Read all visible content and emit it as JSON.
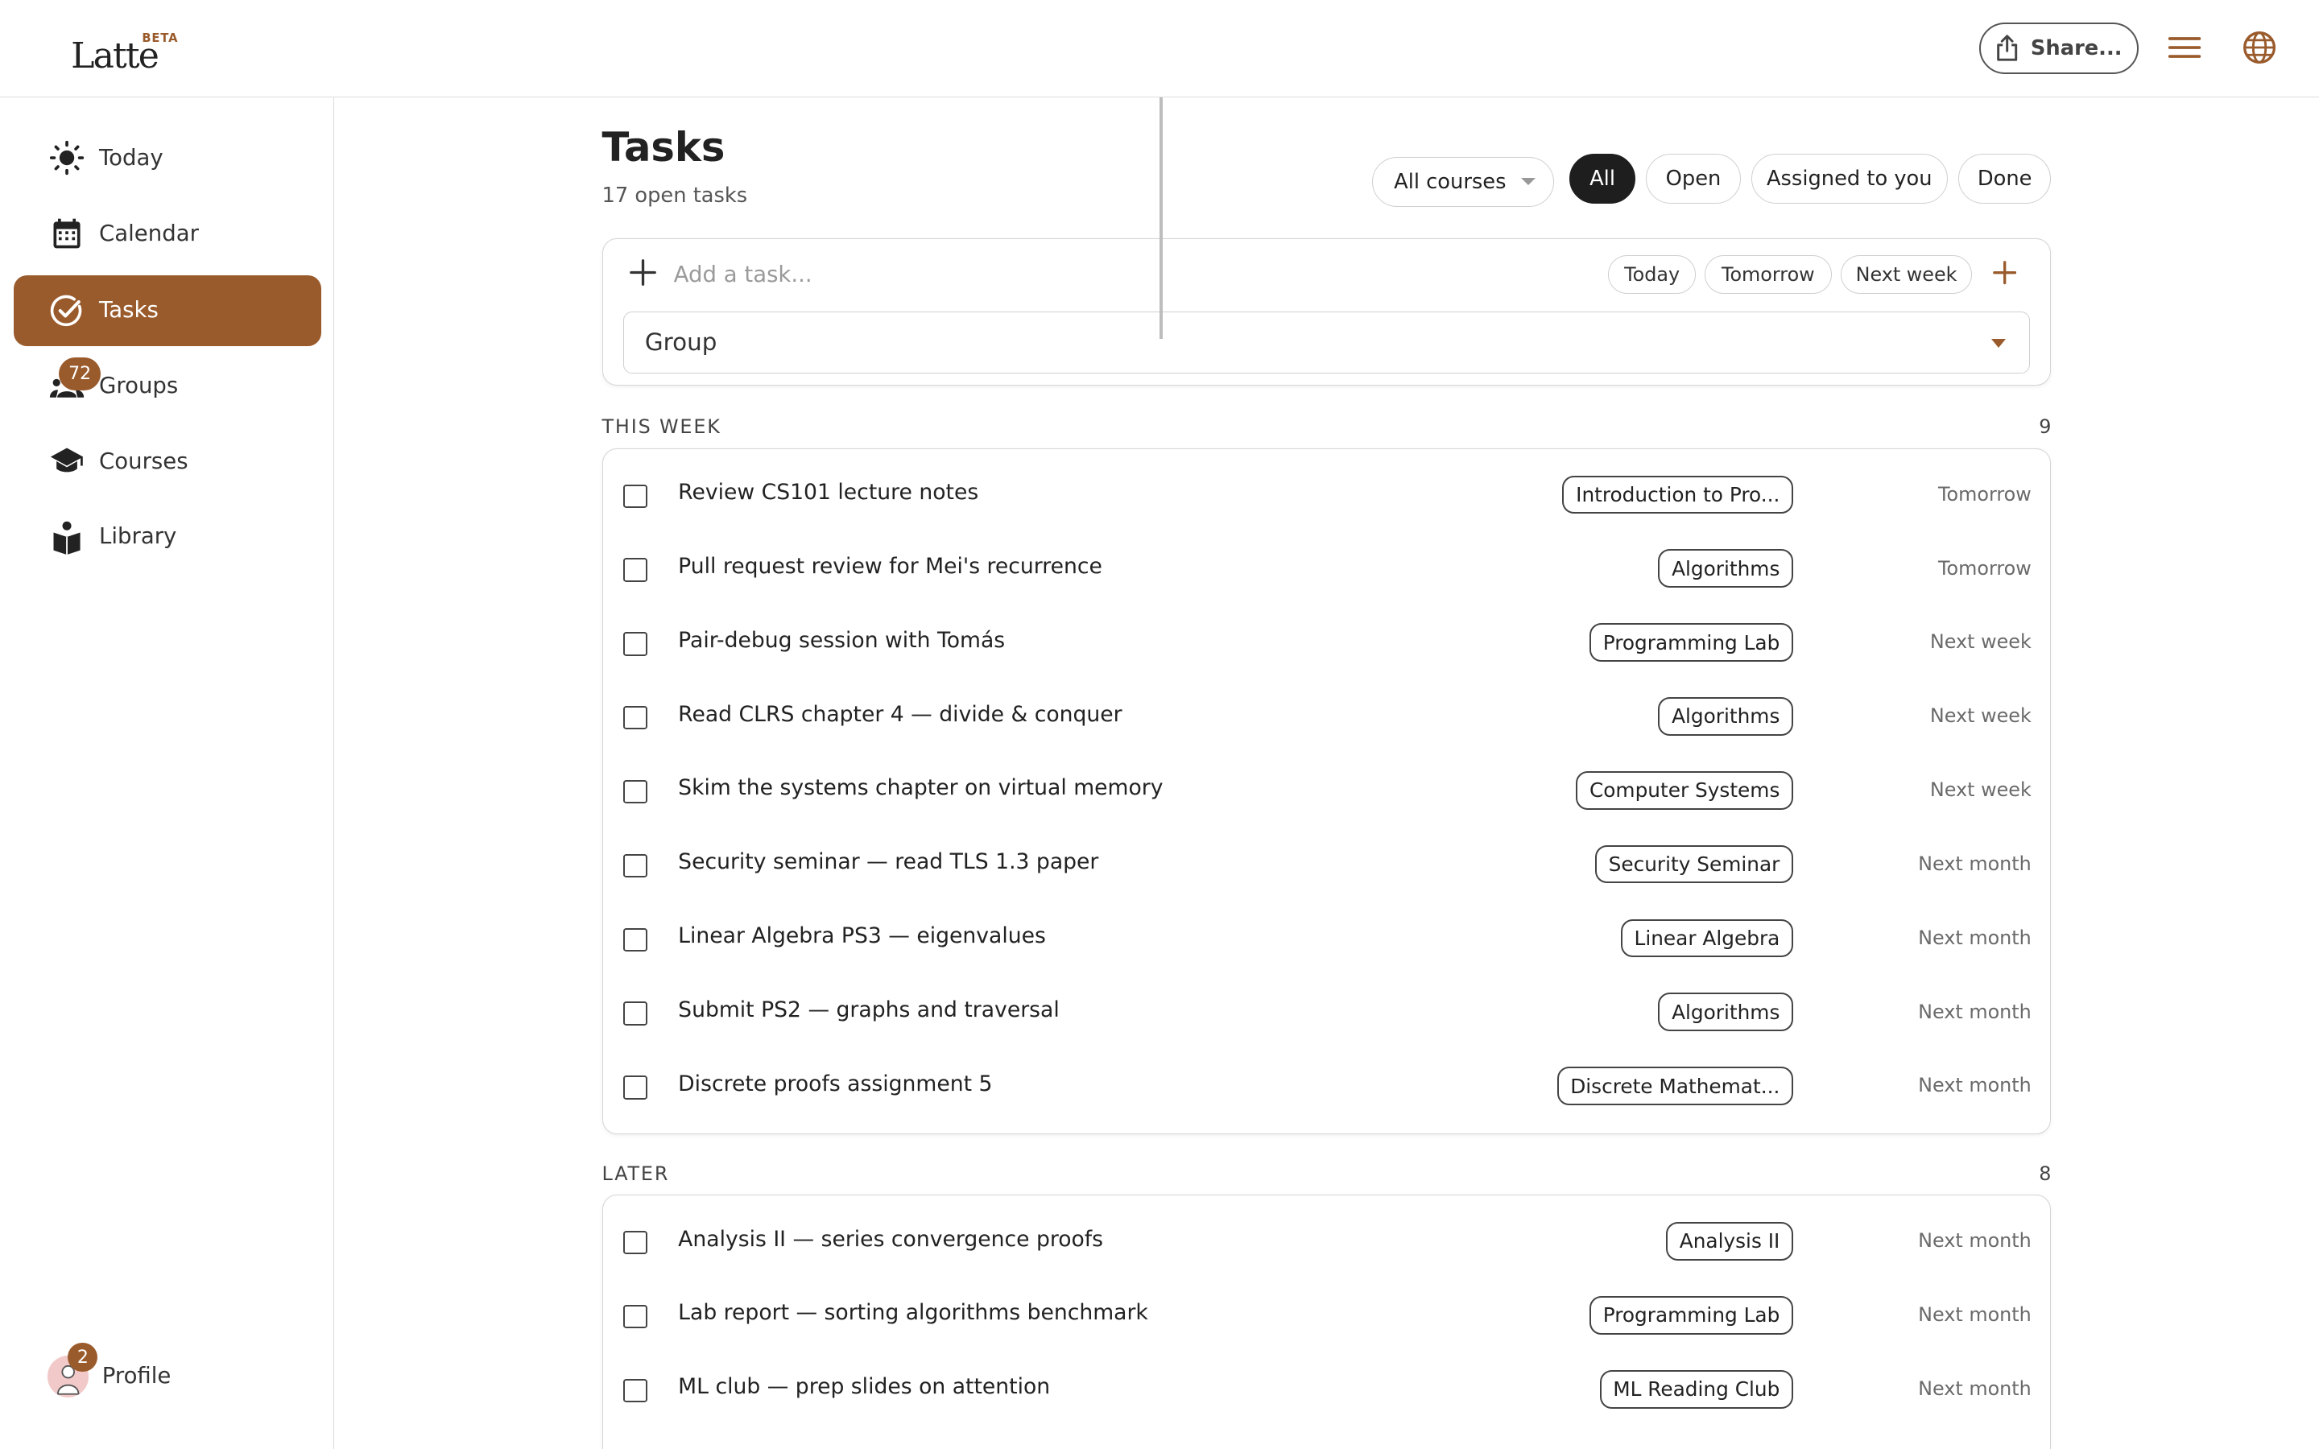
{
  "header": {
    "logo_text": "Latte",
    "beta_label": "BETA",
    "share_label": "Share..."
  },
  "sidebar": {
    "items": [
      {
        "label": "Today",
        "icon": "sun-icon"
      },
      {
        "label": "Calendar",
        "icon": "calendar-icon"
      },
      {
        "label": "Tasks",
        "icon": "check-circle-icon",
        "active": true
      },
      {
        "label": "Groups",
        "icon": "people-icon",
        "badge": "72"
      },
      {
        "label": "Courses",
        "icon": "graduation-cap-icon"
      },
      {
        "label": "Library",
        "icon": "book-reader-icon"
      }
    ],
    "profile": {
      "label": "Profile",
      "badge": "2"
    }
  },
  "main": {
    "title": "Tasks",
    "subtitle": "17 open tasks",
    "filters": {
      "course_select": "All courses",
      "all": "All",
      "open": "Open",
      "assigned": "Assigned to you",
      "done": "Done"
    },
    "add_task": {
      "placeholder": "Add a task...",
      "chips": [
        "Today",
        "Tomorrow",
        "Next week"
      ],
      "group_select": "Group"
    },
    "sections": [
      {
        "name": "THIS WEEK",
        "count": "9",
        "tasks": [
          {
            "title": "Review CS101 lecture notes",
            "tag": "Introduction to Pro...",
            "due": "Tomorrow"
          },
          {
            "title": "Pull request review for Mei's recurrence",
            "tag": "Algorithms",
            "due": "Tomorrow"
          },
          {
            "title": "Pair-debug session with Tomás",
            "tag": "Programming Lab",
            "due": "Next week"
          },
          {
            "title": "Read CLRS chapter 4 — divide & conquer",
            "tag": "Algorithms",
            "due": "Next week"
          },
          {
            "title": "Skim the systems chapter on virtual memory",
            "tag": "Computer Systems",
            "due": "Next week"
          },
          {
            "title": "Security seminar — read TLS 1.3 paper",
            "tag": "Security Seminar",
            "due": "Next month"
          },
          {
            "title": "Linear Algebra PS3 — eigenvalues",
            "tag": "Linear Algebra",
            "due": "Next month"
          },
          {
            "title": "Submit PS2 — graphs and traversal",
            "tag": "Algorithms",
            "due": "Next month"
          },
          {
            "title": "Discrete proofs assignment 5",
            "tag": "Discrete Mathemat...",
            "due": "Next month"
          }
        ]
      },
      {
        "name": "LATER",
        "count": "8",
        "tasks": [
          {
            "title": "Analysis II — series convergence proofs",
            "tag": "Analysis II",
            "due": "Next month"
          },
          {
            "title": "Lab report — sorting algorithms benchmark",
            "tag": "Programming Lab",
            "due": "Next month"
          },
          {
            "title": "ML club — prep slides on attention",
            "tag": "ML Reading Club",
            "due": "Next month"
          }
        ]
      }
    ]
  },
  "colors": {
    "accent": "#9a5b2c",
    "dark_pill": "#1e1e1e",
    "border": "#d5d5d5"
  }
}
